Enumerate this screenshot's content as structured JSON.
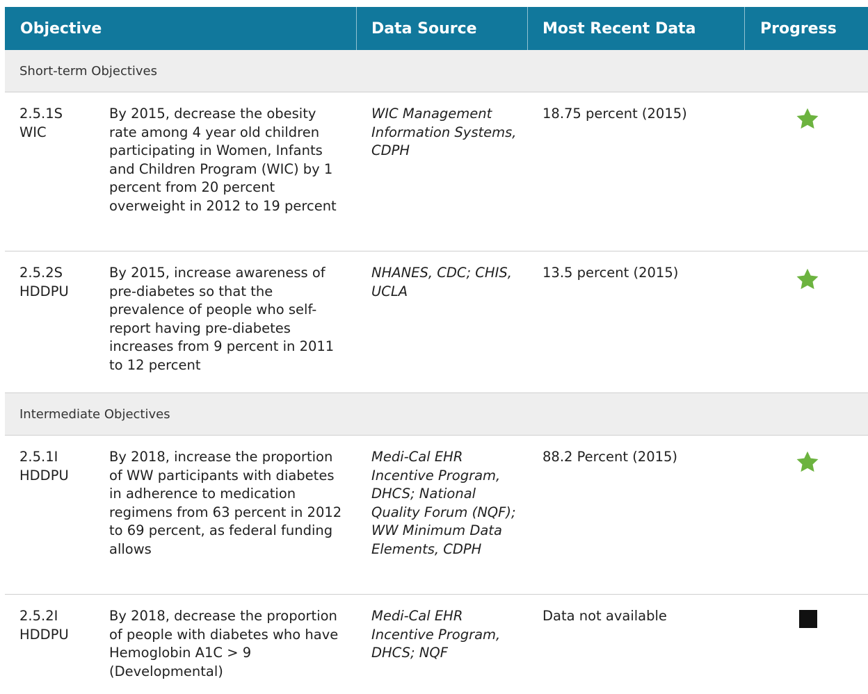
{
  "header": {
    "objective": "Objective",
    "data_source": "Data Source",
    "most_recent_data": "Most Recent Data",
    "progress": "Progress"
  },
  "sections": [
    {
      "title": "Short-term Objectives",
      "rows": [
        {
          "id_line1": "2.5.1S",
          "id_line2": "WIC",
          "objective": "By 2015, decrease the obesity rate among 4 year old children participating in Women, Infants and Children Program (WIC) by 1 percent from 20 percent overweight in 2012 to 19 percent",
          "source": "WIC Management Information Systems, CDPH",
          "recent": "18.75 percent (2015)",
          "progress_icon": "star-icon"
        },
        {
          "id_line1": "2.5.2S",
          "id_line2": "HDDPU",
          "objective": "By 2015, increase awareness of pre-diabetes so that the prevalence of people who self-report having pre-diabetes increases from 9 percent in 2011 to 12 percent",
          "source": "NHANES, CDC; CHIS, UCLA",
          "recent": "13.5 percent (2015)",
          "progress_icon": "star-icon"
        }
      ]
    },
    {
      "title": "Intermediate Objectives",
      "rows": [
        {
          "id_line1": "2.5.1I",
          "id_line2": "HDDPU",
          "objective": "By 2018, increase the proportion of WW participants with diabetes in adherence to medication regimens from 63 percent in 2012 to 69 percent, as federal funding allows",
          "source": "Medi-Cal EHR Incentive Program, DHCS; National Quality Forum (NQF); WW Minimum Data Elements, CDPH",
          "recent": "88.2 Percent (2015)",
          "progress_icon": "star-icon"
        },
        {
          "id_line1": "2.5.2I",
          "id_line2": "HDDPU",
          "objective": "By 2018, decrease the proportion of people with diabetes who have Hemoglobin A1C > 9 (Developmental)",
          "source": "Medi-Cal EHR Incentive Program, DHCS; NQF",
          "recent": "Data not available",
          "progress_icon": "square-icon"
        }
      ]
    }
  ],
  "colors": {
    "header_bg": "#11789c",
    "section_bg": "#eeeeee",
    "star": "#6cb33f",
    "square": "#111111"
  }
}
